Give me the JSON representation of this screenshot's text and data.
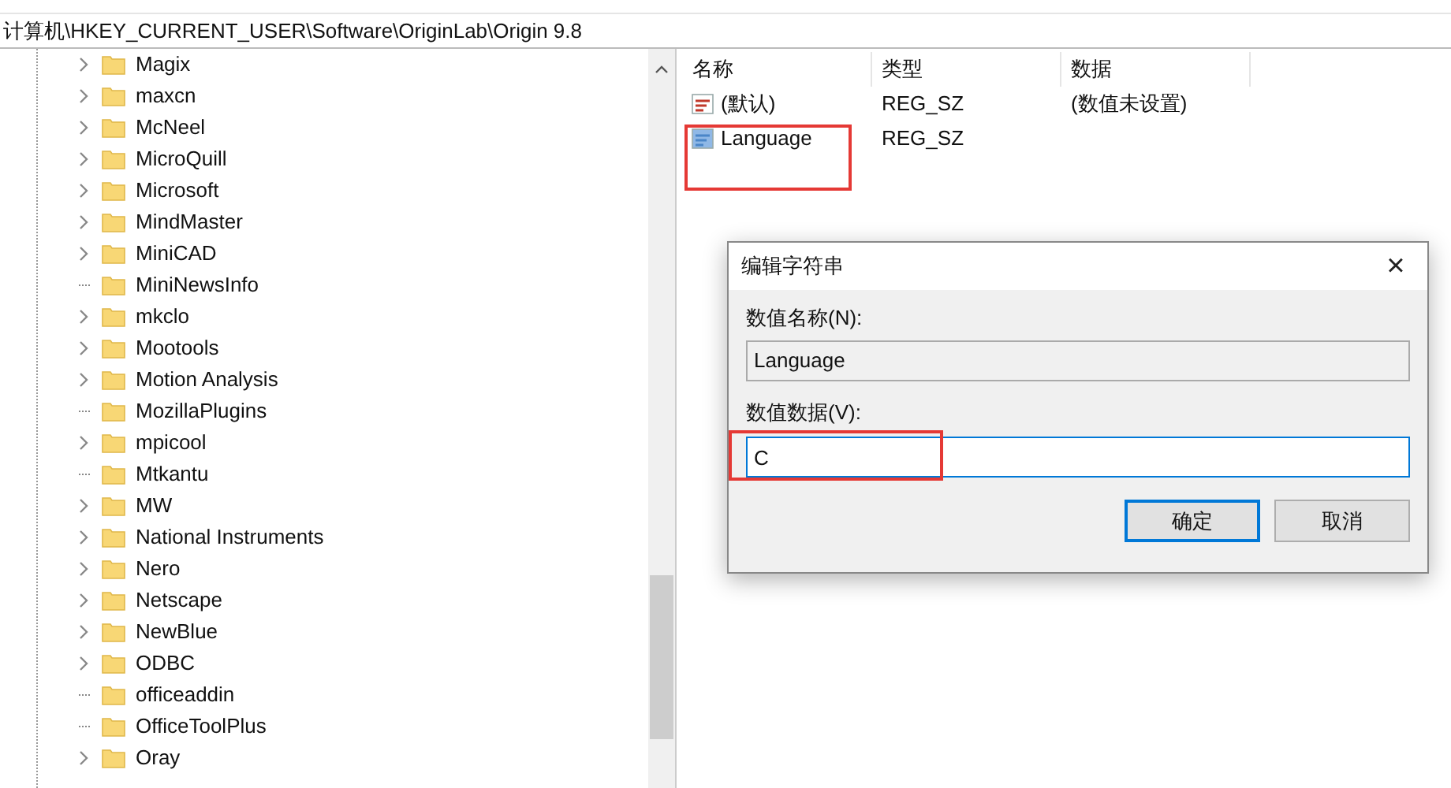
{
  "address_bar": {
    "path": "计算机\\HKEY_CURRENT_USER\\Software\\OriginLab\\Origin 9.8"
  },
  "tree": {
    "items": [
      {
        "label": "Magix",
        "expandable": true
      },
      {
        "label": "maxcn",
        "expandable": true
      },
      {
        "label": "McNeel",
        "expandable": true
      },
      {
        "label": "MicroQuill",
        "expandable": true
      },
      {
        "label": "Microsoft",
        "expandable": true
      },
      {
        "label": "MindMaster",
        "expandable": true
      },
      {
        "label": "MiniCAD",
        "expandable": true
      },
      {
        "label": "MiniNewsInfo",
        "expandable": false
      },
      {
        "label": "mkclo",
        "expandable": true
      },
      {
        "label": "Mootools",
        "expandable": true
      },
      {
        "label": "Motion Analysis",
        "expandable": true
      },
      {
        "label": "MozillaPlugins",
        "expandable": false
      },
      {
        "label": "mpicool",
        "expandable": true
      },
      {
        "label": "Mtkantu",
        "expandable": false
      },
      {
        "label": "MW",
        "expandable": true
      },
      {
        "label": "National Instruments",
        "expandable": true
      },
      {
        "label": "Nero",
        "expandable": true
      },
      {
        "label": "Netscape",
        "expandable": true
      },
      {
        "label": "NewBlue",
        "expandable": true
      },
      {
        "label": "ODBC",
        "expandable": true
      },
      {
        "label": "officeaddin",
        "expandable": false
      },
      {
        "label": "OfficeToolPlus",
        "expandable": false
      },
      {
        "label": "Oray",
        "expandable": true
      }
    ]
  },
  "values": {
    "columns": [
      "名称",
      "类型",
      "数据"
    ],
    "rows": [
      {
        "name": "(默认)",
        "type": "REG_SZ",
        "data": "(数值未设置)",
        "highlighted": false
      },
      {
        "name": "Language",
        "type": "REG_SZ",
        "highlighted": true
      }
    ]
  },
  "dialog": {
    "title": "编辑字符串",
    "close": "×",
    "name_label": "数值名称(N):",
    "name_value": "Language",
    "data_label": "数值数据(V):",
    "data_value": "C",
    "data_highlighted": true,
    "buttons": [
      {
        "label": "确定",
        "default": true
      },
      {
        "label": "取消",
        "default": false
      }
    ]
  }
}
